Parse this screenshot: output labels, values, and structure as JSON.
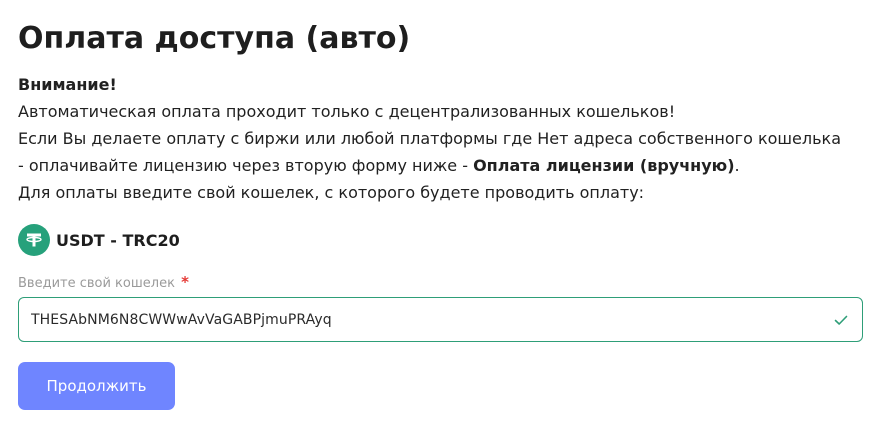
{
  "page": {
    "title": "Оплата доступа (авто)"
  },
  "notice": {
    "heading": "Внимание!",
    "line1": "Автоматическая оплата проходит только с децентрализованных кошельков!",
    "line2": "Если Вы делаете оплату с биржи или любой платформы где Нет адреса собственного кошелька",
    "line3_prefix": "- оплачивайте лицензию через вторую форму ниже - ",
    "line3_bold": "Оплата лицензии (вручную)",
    "line3_suffix": ".",
    "line4": "Для оплаты введите свой кошелек, с которого будете проводить оплату:"
  },
  "currency": {
    "label": "USDT - TRC20",
    "icon": "tether-icon",
    "color": "#26a17b"
  },
  "wallet": {
    "label": "Введите свой кошелек",
    "required_mark": "*",
    "value": "THESAbNM6N8CWWwAvVaGABPjmuPRAyq",
    "valid": true,
    "border_color": "#2e9e78"
  },
  "actions": {
    "continue_label": "Продолжить",
    "continue_color": "#6f85ff"
  }
}
